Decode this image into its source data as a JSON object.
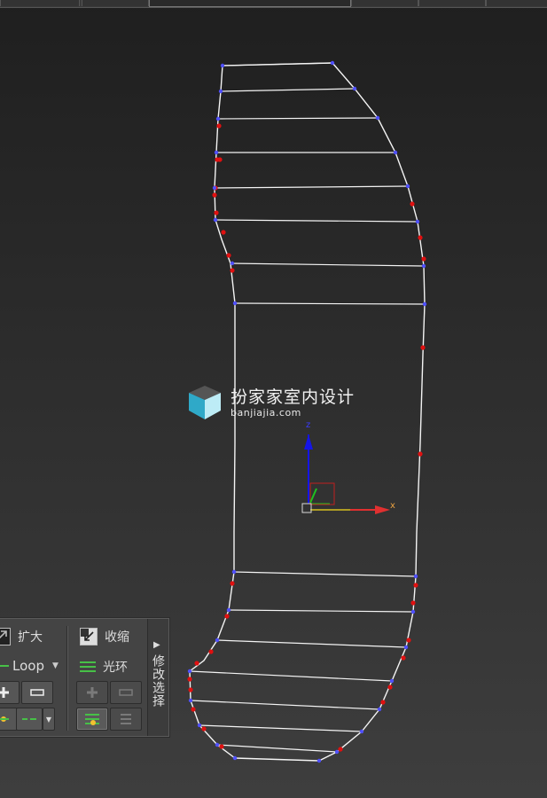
{
  "viewport": {
    "watermark": {
      "name_cn": "扮家家室内设计",
      "url": "banjiajia.com"
    },
    "gizmo": {
      "axis_z": "z",
      "axis_x": "x"
    }
  },
  "panel": {
    "grow_label": "扩大",
    "shrink_label": "收缩",
    "loop_label": "Loop",
    "ring_label": "光环",
    "side_tab_label": "修改选择"
  },
  "colors": {
    "wire": "#f4f4f4",
    "vertex_blue": "#5050ff",
    "vertex_red": "#e01010",
    "gizmo_z": "#1515e8",
    "gizmo_x": "#e03030",
    "gizmo_y": "#20c020"
  }
}
